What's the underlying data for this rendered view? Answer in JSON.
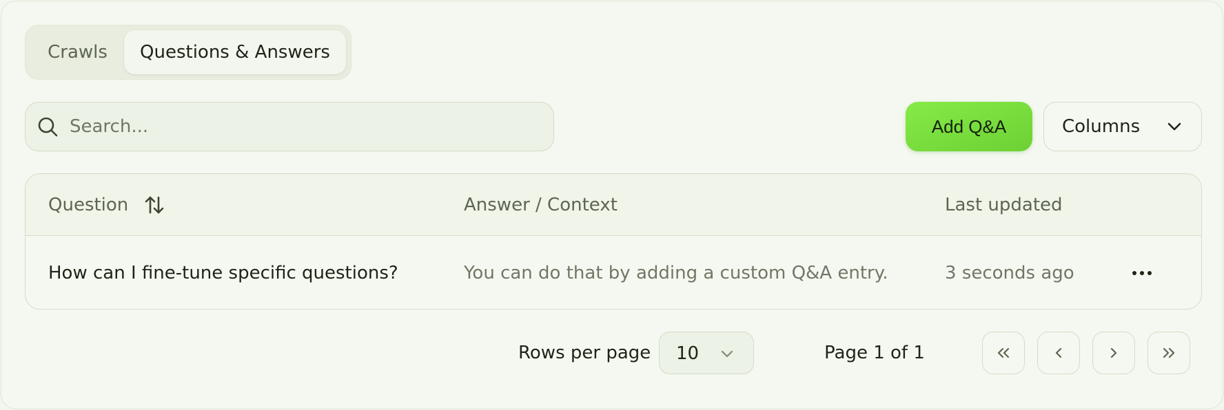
{
  "tabs": [
    {
      "label": "Crawls",
      "active": false
    },
    {
      "label": "Questions & Answers",
      "active": true
    }
  ],
  "search": {
    "placeholder": "Search...",
    "value": "",
    "icon": "search-icon"
  },
  "toolbar": {
    "add_label": "Add Q&A",
    "columns_label": "Columns"
  },
  "table": {
    "headers": {
      "question": "Question",
      "answer": "Answer / Context",
      "updated": "Last updated"
    },
    "rows": [
      {
        "question": "How can I fine-tune specific questions?",
        "answer": "You can do that by adding a custom Q&A entry.",
        "updated": "3 seconds ago"
      }
    ]
  },
  "pagination": {
    "rows_per_page_label": "Rows per page",
    "rows_per_page_value": "10",
    "page_info": "Page 1 of 1"
  },
  "colors": {
    "accent": "#7ddc3e",
    "background": "#f5f8f0",
    "border": "#d4dbc8",
    "muted_text": "#6f7866"
  }
}
